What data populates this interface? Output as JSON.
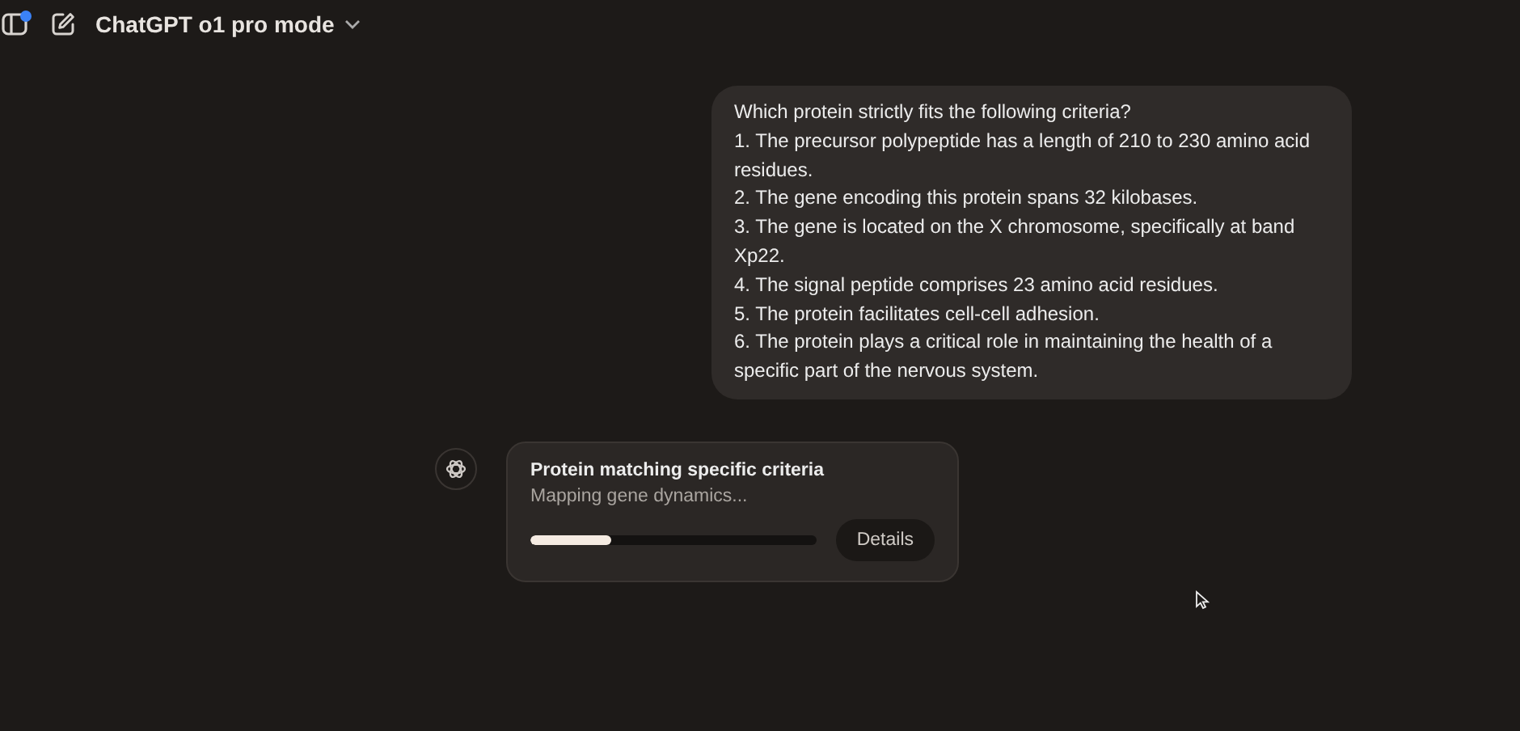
{
  "header": {
    "model_title": "ChatGPT o1 pro mode",
    "sidebar_notification": true
  },
  "user_message": {
    "lines": [
      "Which protein strictly fits the following criteria?",
      "1. The precursor polypeptide has a length of 210 to 230 amino acid residues.",
      "2. The gene encoding this protein spans 32 kilobases.",
      "3. The gene is located on the X chromosome, specifically at band Xp22.",
      "4. The signal peptide comprises 23 amino acid residues.",
      "5. The protein facilitates cell-cell adhesion.",
      "6. The protein plays a critical role in maintaining the health of a specific part of the nervous system."
    ]
  },
  "task_card": {
    "title": "Protein matching specific criteria",
    "status": "Mapping gene dynamics...",
    "level": 0.28,
    "button": "Details"
  }
}
